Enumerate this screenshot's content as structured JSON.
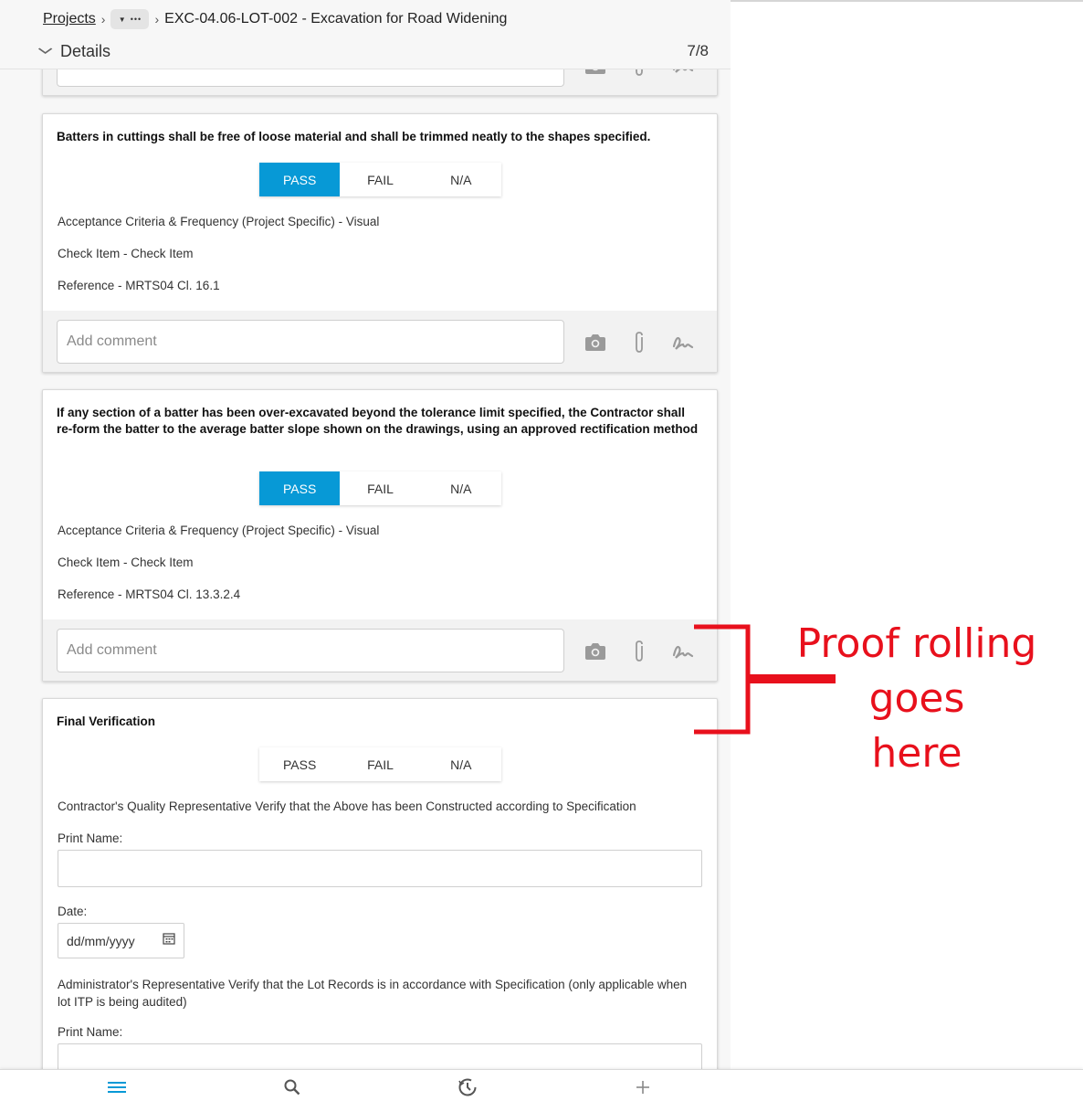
{
  "breadcrumb": {
    "projects": "Projects",
    "ellipsis": "•••",
    "current": "EXC-04.06-LOT-002 - Excavation for Road Widening"
  },
  "details": {
    "label": "Details",
    "count": "7/8"
  },
  "segments": {
    "pass": "PASS",
    "fail": "FAIL",
    "na": "N/A"
  },
  "comment": {
    "placeholder": "Add comment"
  },
  "items": [
    {
      "title": "Batters in cuttings shall be free of loose material and shall be trimmed neatly to the shapes specified.",
      "result": "PASS",
      "acceptance": "Acceptance Criteria & Frequency (Project Specific) - Visual",
      "check": "Check Item - Check Item",
      "reference": "Reference - MRTS04 Cl. 16.1"
    },
    {
      "title": "If any section of a batter has been over-excavated beyond the tolerance limit specified, the Contractor shall re-form the batter to the average batter slope shown on the drawings, using an approved rectification method",
      "result": "PASS",
      "acceptance": "Acceptance Criteria & Frequency (Project Specific) - Visual",
      "check": "Check Item - Check Item",
      "reference": "Reference - MRTS04 Cl. 13.3.2.4"
    }
  ],
  "final": {
    "title": "Final Verification",
    "contractor_text": "Contractor's Quality Representative Verify that the Above has been Constructed according to Specification",
    "print_name_label": "Print Name:",
    "date_label": "Date:",
    "date_placeholder": "dd/mm/yyyy",
    "admin_text": "Administrator's Representative Verify that the Lot Records is in accordance with Specification (only applicable when lot ITP is being audited)",
    "print_name_label_2": "Print Name:"
  },
  "annotation": {
    "line1": "Proof rolling goes",
    "line2": "here",
    "color": "#e8101c"
  },
  "icons": [
    "menu-icon",
    "search-icon",
    "activity-icon",
    "plus-icon",
    "camera-icon",
    "paperclip-icon",
    "signature-icon",
    "calendar-icon",
    "chevron-down-icon"
  ],
  "colors": {
    "accent": "#0799d6",
    "annotation": "#e8101c"
  }
}
